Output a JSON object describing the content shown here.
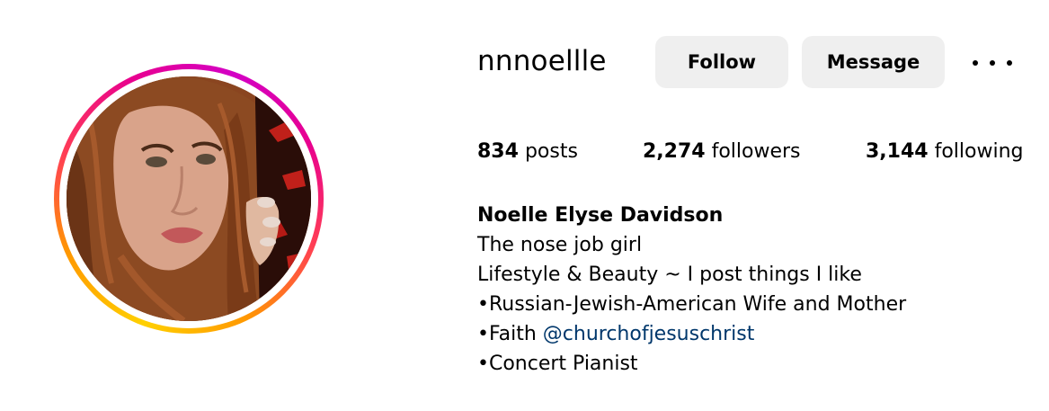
{
  "profile": {
    "username": "nnnoellle",
    "avatar_icon": "profile-photo"
  },
  "actions": {
    "follow_label": "Follow",
    "message_label": "Message",
    "more_icon": "more-options-icon"
  },
  "stats": {
    "posts_count": "834",
    "posts_label": "posts",
    "followers_count": "2,274",
    "followers_label": "followers",
    "following_count": "3,144",
    "following_label": "following"
  },
  "bio": {
    "full_name": "Noelle Elyse Davidson",
    "line1": "The nose job girl",
    "line2": "Lifestyle & Beauty ~ I post things I like",
    "line3": "•Russian-Jewish-American Wife and Mother",
    "line4_prefix": "•Faith ",
    "line4_mention": "@churchofjesuschrist",
    "line5": "•Concert Pianist"
  },
  "colors": {
    "button_bg": "#efefef",
    "mention": "#00376b",
    "ring_gradient": [
      "#ffd000",
      "#ff3d55",
      "#d300c5"
    ]
  }
}
